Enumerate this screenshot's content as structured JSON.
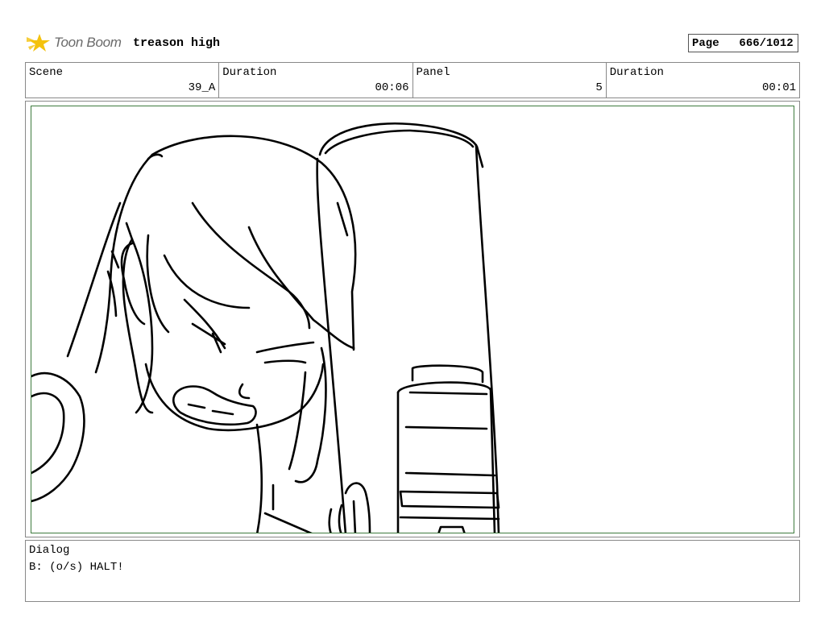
{
  "header": {
    "logo_text": "Toon Boom",
    "project_title": "treason high",
    "page_label": "Page",
    "page_value": "666/1012"
  },
  "info": {
    "scene_label": "Scene",
    "scene_value": "39_A",
    "duration_label": "Duration",
    "duration_value": "00:06",
    "panel_label": "Panel",
    "panel_value": "5",
    "panel_duration_label": "Duration",
    "panel_duration_value": "00:01"
  },
  "dialog": {
    "label": "Dialog",
    "text": "B: (o/s) HALT!"
  },
  "colors": {
    "frame_border": "#3d7a3d",
    "logo_yellow": "#f4c20d",
    "logo_text": "#6a6a6a"
  },
  "icons": {
    "logo": "toon-boom-star-logo"
  }
}
